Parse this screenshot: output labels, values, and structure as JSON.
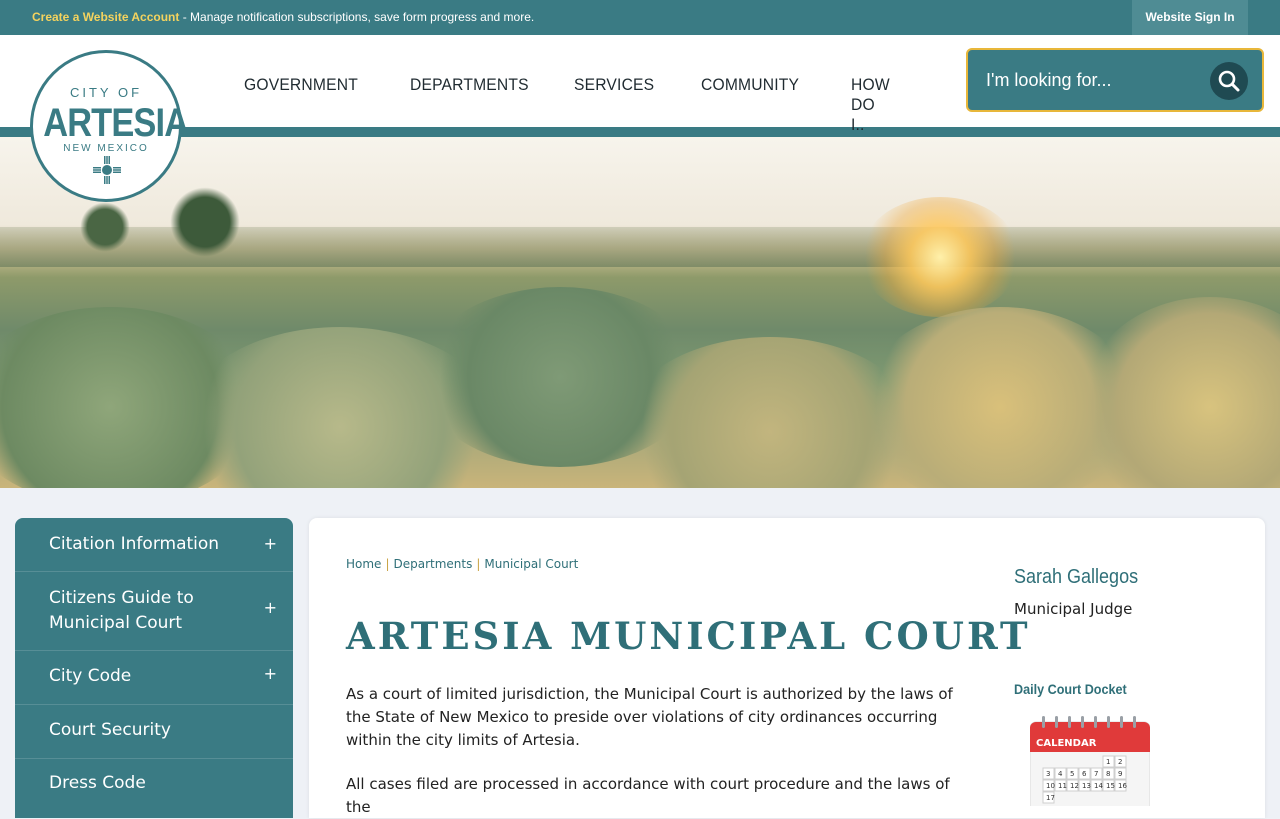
{
  "topbar": {
    "create_account": "Create a Website Account",
    "message": " - Manage notification subscriptions, save form progress and more.",
    "sign_in": "Website Sign In"
  },
  "logo": {
    "city_of": "CITY OF",
    "name": "ARTESIA",
    "state": "NEW MEXICO"
  },
  "nav": {
    "items": [
      "GOVERNMENT",
      "DEPARTMENTS",
      "SERVICES",
      "COMMUNITY",
      "HOW DO I.."
    ]
  },
  "search": {
    "placeholder": "I'm looking for..."
  },
  "sidebar": {
    "items": [
      {
        "label": "Citation Information",
        "expand": "+"
      },
      {
        "label": "Citizens Guide to Municipal Court",
        "expand": "+"
      },
      {
        "label": "City Code",
        "expand": "+"
      },
      {
        "label": "Court Security"
      },
      {
        "label": "Dress Code"
      }
    ]
  },
  "breadcrumb": {
    "items": [
      "Home",
      "Departments",
      "Municipal Court"
    ],
    "separator": "|"
  },
  "main": {
    "title": "ARTESIA MUNICIPAL COURT",
    "paragraph1": "As a court of limited jurisdiction, the Municipal Court is authorized by the laws of the State of New Mexico to preside over violations of city ordinances occurring within the city limits of Artesia.",
    "paragraph2": "All cases filed are processed in accordance with court procedure and the laws of the"
  },
  "aside": {
    "name": "Sarah Gallegos",
    "role": "Municipal Judge",
    "docket": "Daily Court Docket",
    "calendar_label": "CALENDAR",
    "calendar_days": [
      "1",
      "2",
      "3",
      "4",
      "5",
      "6",
      "7",
      "8",
      "9",
      "10",
      "11",
      "12",
      "13",
      "14",
      "15",
      "16",
      "17"
    ]
  },
  "colors": {
    "teal": "#3a7b84",
    "accent_yellow": "#f4d35e",
    "search_border": "#e8b73a",
    "calendar_red": "#e03a3a"
  }
}
